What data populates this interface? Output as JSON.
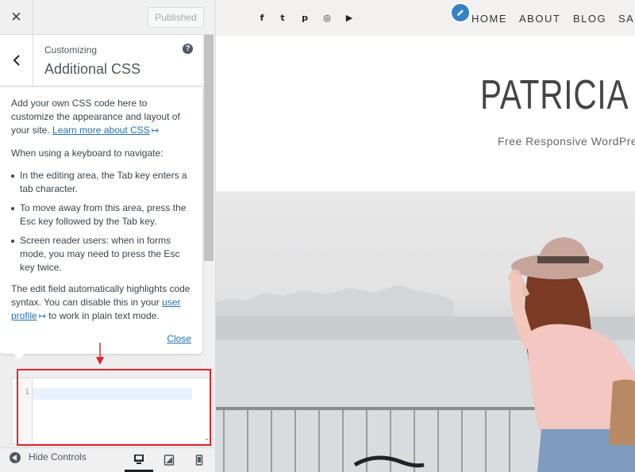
{
  "topbar": {
    "close_glyph": "✕",
    "publish_label": "Published"
  },
  "section": {
    "customizing_label": "Customizing",
    "title": "Additional CSS",
    "help_glyph": "?"
  },
  "help": {
    "intro": "Add your own CSS code here to customize the appearance and layout of your site.",
    "learn_more_link": "Learn more about CSS",
    "keyboard_heading": "When using a keyboard to navigate:",
    "bullets": [
      "In the editing area, the Tab key enters a tab character.",
      "To move away from this area, press the Esc key followed by the Tab key.",
      "Screen reader users: when in forms mode, you may need to press the Esc key twice."
    ],
    "highlight_text_before": "The edit field automatically highlights code syntax. You can disable this in your",
    "user_profile_link": "user profile",
    "highlight_text_after": "to work in plain text mode.",
    "close_label": "Close"
  },
  "editor": {
    "line_number": "1",
    "content": "",
    "scroll_glyph": "⌄"
  },
  "footer": {
    "hide_controls_label": "Hide Controls",
    "devices": [
      "desktop-icon",
      "tablet-icon",
      "mobile-icon"
    ],
    "active_device": "desktop"
  },
  "site": {
    "social_icons": [
      "facebook-icon",
      "twitter-icon",
      "pinterest-icon",
      "instagram-icon",
      "youtube-icon"
    ],
    "social_glyphs": [
      "f",
      "t",
      "p",
      "◎",
      "▶"
    ],
    "menu": [
      "HOME",
      "ABOUT",
      "BLOG",
      "SAN"
    ],
    "title": "PATRICIA",
    "tagline": "Free Responsive WordPre"
  },
  "colors": {
    "accent": "#2271b1",
    "annotation_red": "#e3262b",
    "shortcut_blue": "#3582c4"
  }
}
